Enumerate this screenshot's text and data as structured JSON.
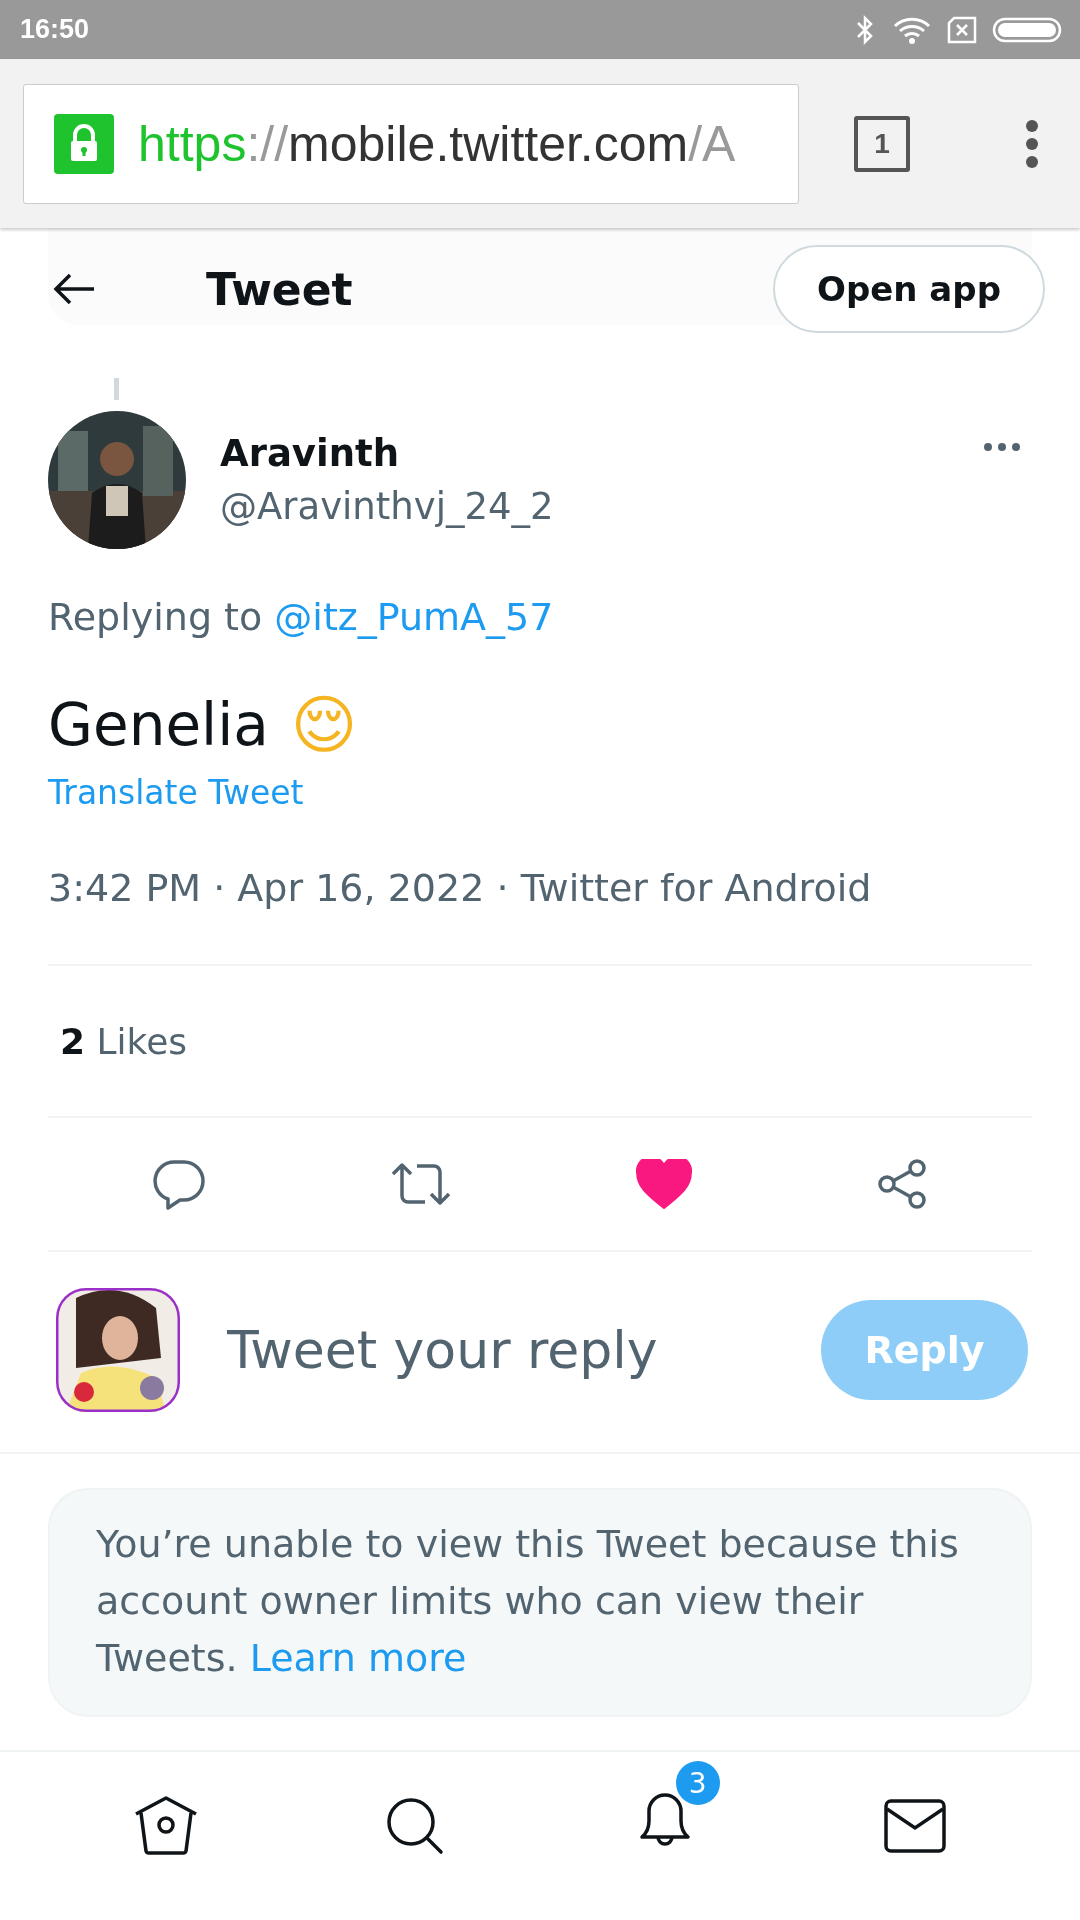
{
  "status_bar": {
    "time": "16:50"
  },
  "browser": {
    "url_scheme": "https",
    "url_sep": "://",
    "url_host": "mobile.twitter.com",
    "url_rest": "/A",
    "tab_count": "1"
  },
  "header": {
    "title": "Tweet",
    "open_app": "Open app"
  },
  "tweet": {
    "name": "Aravinth",
    "handle": "@Aravinthvj_24_2",
    "replying_label": "Replying to",
    "replying_handle": "@itz_PumA_57",
    "text": "Genelia",
    "emoji": "😌",
    "translate": "Translate Tweet",
    "timestamp": "3:42 PM · Apr 16, 2022 · Twitter for Android",
    "likes_count": "2",
    "likes_label": "Likes",
    "liked": true
  },
  "reply_box": {
    "placeholder": "Tweet your reply",
    "button": "Reply",
    "disabled": true
  },
  "notice": {
    "text": "You’re unable to view this Tweet because this account owner limits who can view their Tweets.",
    "link": "Learn more"
  },
  "bottom_nav": {
    "notifications_badge": "3"
  }
}
